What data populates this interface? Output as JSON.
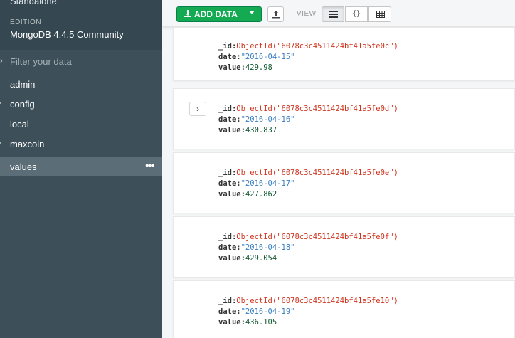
{
  "sidebar": {
    "topology": "Standalone",
    "edition_label": "EDITION",
    "edition_value": "MongoDB 4.4.5 Community",
    "filter_placeholder": "Filter your data",
    "databases": [
      {
        "label": "admin",
        "active": false
      },
      {
        "label": "config",
        "active": false
      },
      {
        "label": "local",
        "active": false
      },
      {
        "label": "maxcoin",
        "active": false
      },
      {
        "label": "values",
        "active": true
      }
    ],
    "more_label": "•••"
  },
  "toolbar": {
    "add_data_label": "ADD DATA",
    "view_label": "VIEW",
    "json_view_label": "{}"
  },
  "documents": [
    {
      "id_key": "_id:",
      "id_value": "ObjectId(\"6078c3c4511424bf41a5fe0c\")",
      "date_key": "date:",
      "date_value": "\"2016-04-15\"",
      "value_key": "value:",
      "value_value": "429.98"
    },
    {
      "id_key": "_id:",
      "id_value": "ObjectId(\"6078c3c4511424bf41a5fe0d\")",
      "date_key": "date:",
      "date_value": "\"2016-04-16\"",
      "value_key": "value:",
      "value_value": "430.837"
    },
    {
      "id_key": "_id:",
      "id_value": "ObjectId(\"6078c3c4511424bf41a5fe0e\")",
      "date_key": "date:",
      "date_value": "\"2016-04-17\"",
      "value_key": "value:",
      "value_value": "427.862"
    },
    {
      "id_key": "_id:",
      "id_value": "ObjectId(\"6078c3c4511424bf41a5fe0f\")",
      "date_key": "date:",
      "date_value": "\"2016-04-18\"",
      "value_key": "value:",
      "value_value": "429.054"
    },
    {
      "id_key": "_id:",
      "id_value": "ObjectId(\"6078c3c4511424bf41a5fe10\")",
      "date_key": "date:",
      "date_value": "\"2016-04-19\"",
      "value_key": "value:",
      "value_value": "436.105"
    }
  ],
  "colors": {
    "sidebar_bg": "#3d4f58",
    "add_data_green": "#13aa52",
    "objectid_red": "#d0351f",
    "string_blue": "#3b7fc4",
    "number_green": "#145a32"
  }
}
